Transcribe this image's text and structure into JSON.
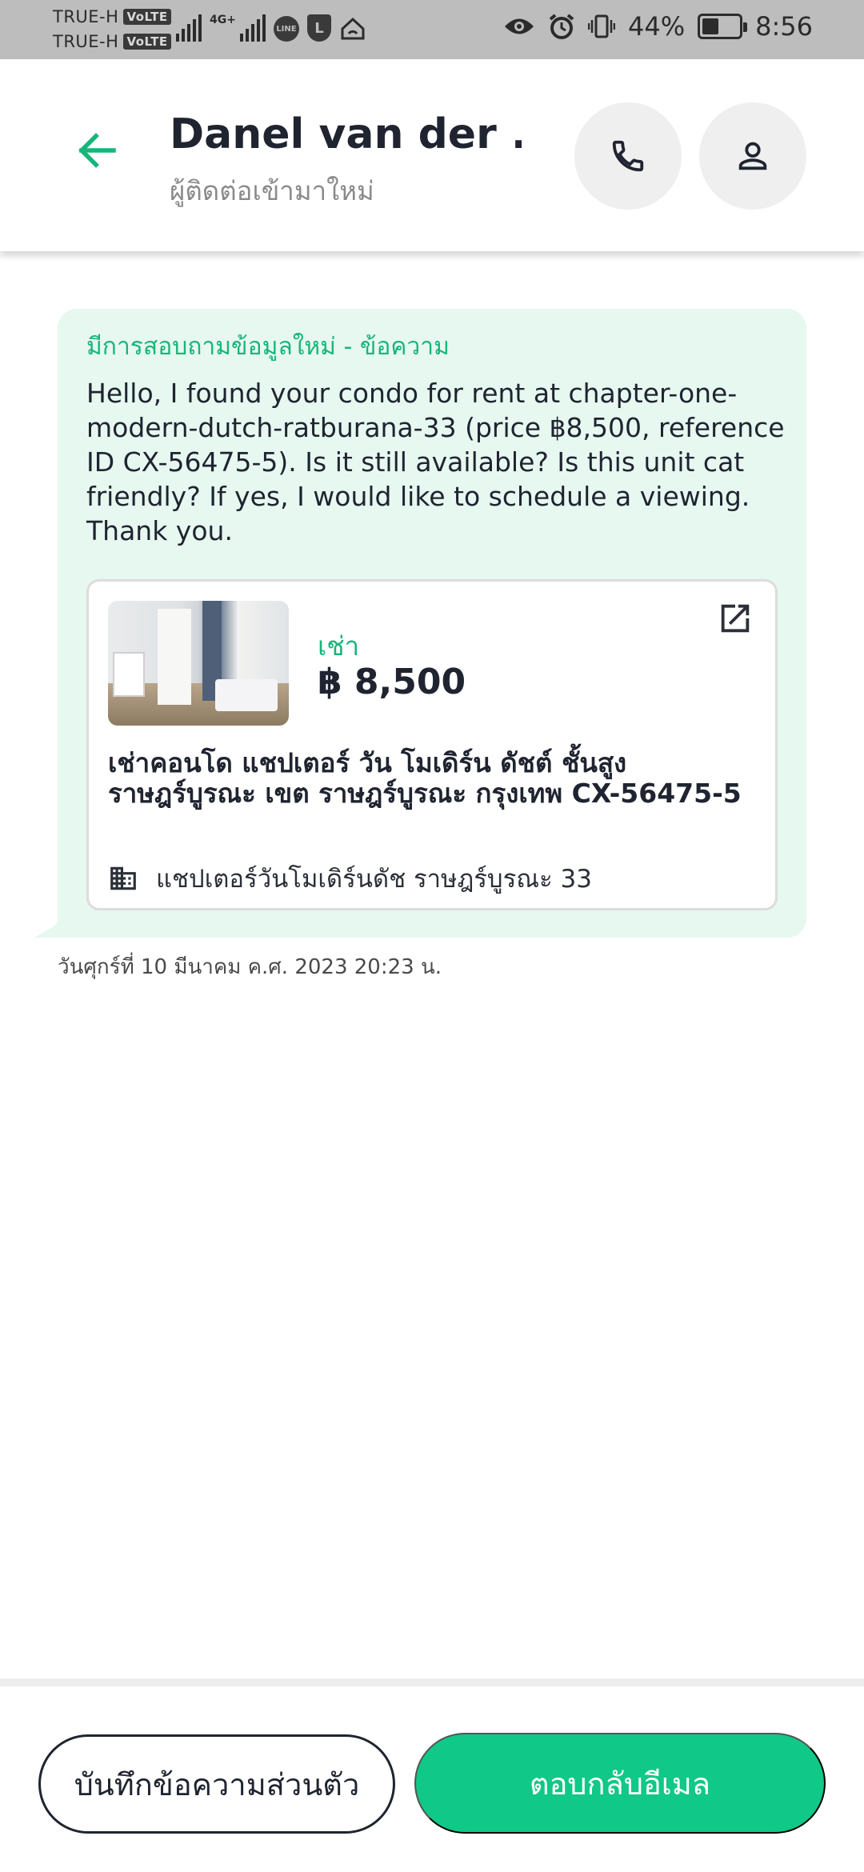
{
  "status_bar": {
    "carrier_1": "TRUE-H",
    "carrier_2": "TRUE-H",
    "volte_label": "VoLTE",
    "network_tag": "4G+",
    "line_badge": "LINE",
    "l_badge": "L",
    "battery_percent": "44%",
    "battery_level": 0.44,
    "time": "8:56"
  },
  "header": {
    "contact_name": "Danel  van der ...",
    "contact_subtitle": "ผู้ติดต่อเข้ามาใหม่",
    "icons": {
      "back": "arrow-left-icon",
      "call": "phone-icon",
      "profile": "person-icon"
    }
  },
  "message": {
    "title": "มีการสอบถามข้อมูลใหม่ - ข้อความ",
    "body": "Hello, I found your condo for rent at chapter-one-modern-dutch-ratburana-33 (price ฿8,500, reference ID CX-56475-5). Is it still available? Is this unit cat friendly? If yes, I would like to schedule a viewing. Thank you.",
    "timestamp": "วันศุกร์ที่ 10 มีนาคม ค.ศ. 2023 20:23 น."
  },
  "listing": {
    "type_label": "เช่า",
    "price": "฿ 8,500",
    "title": "เช่าคอนโด  แชปเตอร์ วัน โมเดิร์น ดัชต์  ชั้นสูง ราษฎร์บูรณะ เขต ราษฎร์บูรณะ กรุงเทพ CX-56475-5",
    "building_name": "แชปเตอร์วันโมเดิร์นดัช ราษฎร์บูรณะ 33",
    "icons": {
      "external": "open-external-icon",
      "building": "building-icon"
    }
  },
  "actions": {
    "private_note_label": "บันทึกข้อความส่วนตัว",
    "reply_email_label": "ตอบกลับอีเมล"
  },
  "colors": {
    "accent_green": "#10c887",
    "bubble_background": "#e6f8f0",
    "status_bar_background": "#bdbdbd"
  }
}
